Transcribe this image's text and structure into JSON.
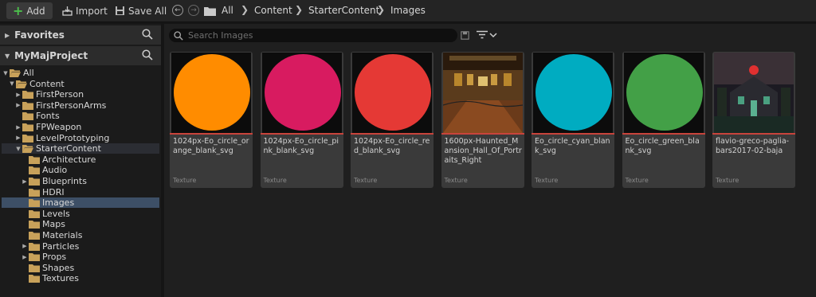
{
  "toolbar": {
    "add_label": "Add",
    "import_label": "Import",
    "saveall_label": "Save All",
    "breadcrumb": [
      "All",
      "Content",
      "StarterContent",
      "Images"
    ]
  },
  "left_panel": {
    "favorites_title": "Favorites",
    "project_title": "MyMajProject",
    "tree": [
      {
        "label": "All",
        "level": 0,
        "expanded": true
      },
      {
        "label": "Content",
        "level": 1,
        "expanded": true
      },
      {
        "label": "FirstPerson",
        "level": 2,
        "arrow": true
      },
      {
        "label": "FirstPersonArms",
        "level": 2,
        "arrow": true
      },
      {
        "label": "Fonts",
        "level": 2,
        "arrow": false
      },
      {
        "label": "FPWeapon",
        "level": 2,
        "arrow": true
      },
      {
        "label": "LevelPrototyping",
        "level": 2,
        "arrow": true
      },
      {
        "label": "StarterContent",
        "level": 2,
        "expanded": true
      },
      {
        "label": "Architecture",
        "level": 3,
        "arrow": false
      },
      {
        "label": "Audio",
        "level": 3,
        "arrow": false
      },
      {
        "label": "Blueprints",
        "level": 3,
        "arrow": true
      },
      {
        "label": "HDRI",
        "level": 3,
        "arrow": false
      },
      {
        "label": "Images",
        "level": 3,
        "arrow": false,
        "selected": true
      },
      {
        "label": "Levels",
        "level": 3,
        "arrow": false
      },
      {
        "label": "Maps",
        "level": 3,
        "arrow": false
      },
      {
        "label": "Materials",
        "level": 3,
        "arrow": false
      },
      {
        "label": "Particles",
        "level": 3,
        "arrow": true
      },
      {
        "label": "Props",
        "level": 3,
        "arrow": true
      },
      {
        "label": "Shapes",
        "level": 3,
        "arrow": false
      },
      {
        "label": "Textures",
        "level": 3,
        "arrow": false
      }
    ]
  },
  "search": {
    "placeholder": "Search Images"
  },
  "assets": [
    {
      "name": "1024px-Eo_circle_orange_blank_svg",
      "type": "Texture",
      "thumb": "circle",
      "color": "#ff8c00"
    },
    {
      "name": "1024px-Eo_circle_pink_blank_svg",
      "type": "Texture",
      "thumb": "circle",
      "color": "#d81b60"
    },
    {
      "name": "1024px-Eo_circle_red_blank_svg",
      "type": "Texture",
      "thumb": "circle",
      "color": "#e53935"
    },
    {
      "name": "1600px-Haunted_Mansion_Hall_Of_Portraits_Right",
      "type": "Texture",
      "thumb": "hall"
    },
    {
      "name": "Eo_circle_cyan_blank_svg",
      "type": "Texture",
      "thumb": "circle",
      "color": "#00acc1"
    },
    {
      "name": "Eo_circle_green_blank_svg",
      "type": "Texture",
      "thumb": "circle",
      "color": "#43a047"
    },
    {
      "name": "flavio-greco-paglia-bars2017-02-baja",
      "type": "Texture",
      "thumb": "mansion"
    }
  ]
}
